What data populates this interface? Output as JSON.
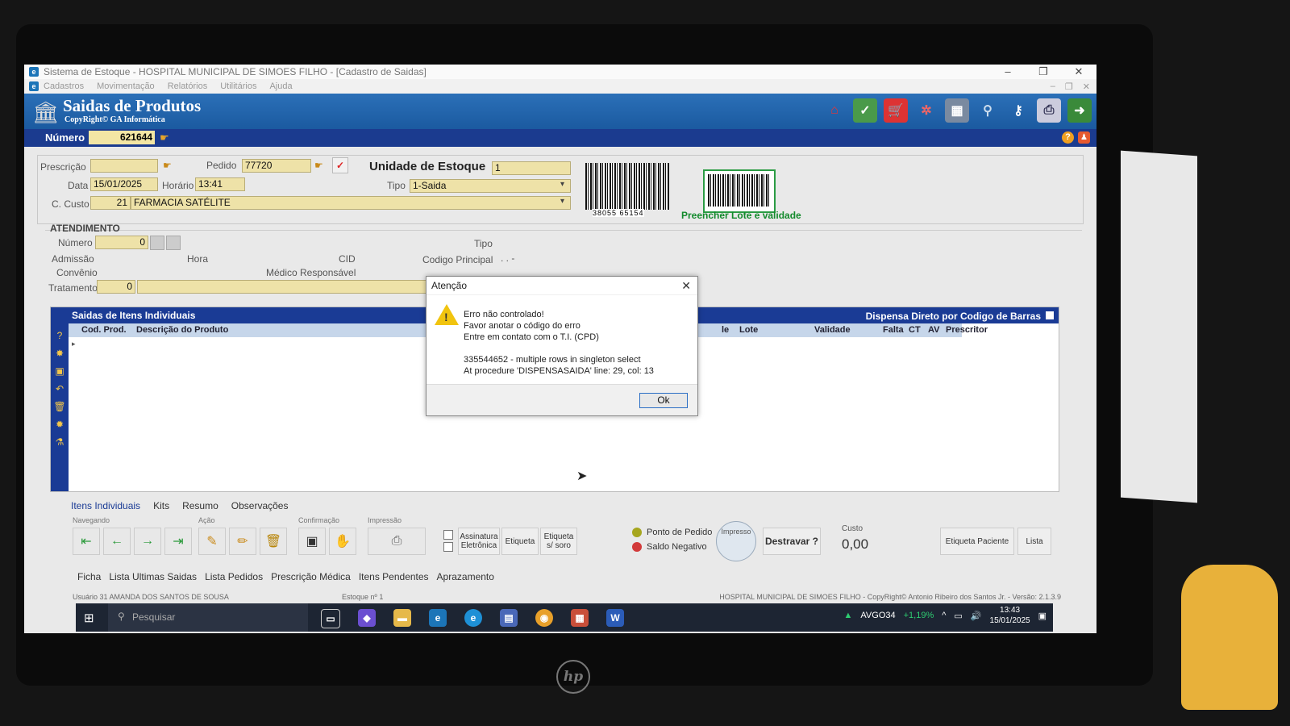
{
  "window": {
    "title": "Sistema de Estoque - HOSPITAL MUNICIPAL DE SIMOES FILHO - [Cadastro de Saidas]",
    "menu": [
      "Cadastros",
      "Movimentação",
      "Relatórios",
      "Utilitários",
      "Ajuda"
    ]
  },
  "header": {
    "title": "Saidas de Produtos",
    "copyright": "CopyRight© GA Informática",
    "toolbar_icons": [
      "home-icon",
      "cart-check-icon",
      "shopping-cart-icon",
      "molecule-icon",
      "calculator-icon",
      "binoculars-icon",
      "key-icon",
      "printer-icon",
      "exit-icon"
    ]
  },
  "numero": {
    "label": "Número",
    "value": "621644"
  },
  "form": {
    "prescricao_label": "Prescrição",
    "prescricao_value": "",
    "pedido_label": "Pedido",
    "pedido_value": "77720",
    "unidade_label": "Unidade de Estoque",
    "unidade_value": "1",
    "data_label": "Data",
    "data_value": "15/01/2025",
    "horario_label": "Horário",
    "horario_value": "13:41",
    "tipo_label": "Tipo",
    "tipo_value": "1-Saida",
    "ccusto_label": "C. Custo",
    "ccusto_code": "21",
    "ccusto_name": "FARMACIA SATÉLITE",
    "barcode_number": "38055 65154",
    "barcode_caption": "Preencher Lote e validade"
  },
  "atendimento": {
    "section": "ATENDIMENTO",
    "numero_label": "Número",
    "numero_value": "0",
    "tipo_label": "Tipo",
    "admissao_label": "Admissão",
    "hora_label": "Hora",
    "cid_label": "CID",
    "codigo_principal_label": "Codigo Principal",
    "codigo_principal_value": ". . -",
    "convenio_label": "Convênio",
    "medico_label": "Médico Responsável",
    "tratamento_label": "Tratamento",
    "tratamento_value": "0"
  },
  "grid": {
    "title": "Saidas de Itens Individuais",
    "right_title": "Dispensa Direto por Codigo de Barras",
    "columns_left": [
      "Cod. Prod.",
      "Descrição do Produto"
    ],
    "columns_right": [
      "le",
      "Lote",
      "Validade",
      "Falta",
      "CT",
      "AV",
      "Prescritor"
    ]
  },
  "dialog": {
    "title": "Atenção",
    "line1": "Erro não controlado!",
    "line2": "Favor anotar o código do erro",
    "line3": "Entre em contato com o T.I. (CPD)",
    "line4": "335544652 - multiple rows in singleton select",
    "line5": "At procedure 'DISPENSASAIDA' line: 29, col: 13",
    "ok": "Ok"
  },
  "tabs": [
    "Itens Individuais",
    "Kits",
    "Resumo",
    "Observações"
  ],
  "panel": {
    "navegando": "Navegando",
    "acao": "Ação",
    "confirmacao": "Confirmação",
    "impressao": "Impressão",
    "assinatura": "Assinatura Eletrônica",
    "etiqueta": "Etiqueta",
    "etiqueta_soro": "Etiqueta s/ soro",
    "ponto_pedido": "Ponto de Pedido",
    "saldo_negativo": "Saldo Negativo",
    "impresso": "Impresso",
    "destravar": "Destravar ?",
    "custo_label": "Custo",
    "custo_value": "0,00",
    "etiqueta_paciente": "Etiqueta Paciente",
    "lista": "Lista",
    "ponto_color": "#a6a61e",
    "saldo_color": "#d23a3a"
  },
  "links": [
    "Ficha",
    "Lista Ultimas Saidas",
    "Lista Pedidos",
    "Prescrição Médica",
    "Itens Pendentes",
    "Aprazamento"
  ],
  "status": {
    "user": "Usuário 31 AMANDA DOS SANTOS DE SOUSA",
    "estoque": "Estoque nº 1",
    "company": "HOSPITAL MUNICIPAL DE SIMOES FILHO - CopyRight© Antonio Ribeiro dos Santos Jr. - Versão: 2.1.3.9"
  },
  "taskbar": {
    "search": "Pesquisar",
    "ticker": "AVGO34",
    "ticker_change": "+1,19%",
    "time": "13:43",
    "date": "15/01/2025"
  }
}
